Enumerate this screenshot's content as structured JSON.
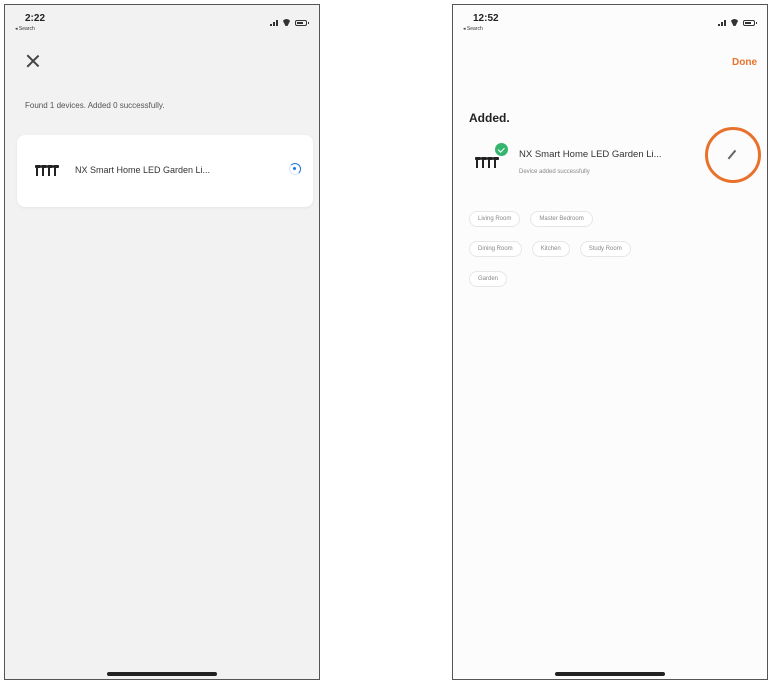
{
  "left_screen": {
    "status": {
      "time": "2:22",
      "back": "◂ Search"
    },
    "found_text": "Found 1 devices. Added 0 successfully.",
    "device": {
      "name": "NX Smart Home LED Garden Li..."
    }
  },
  "right_screen": {
    "status": {
      "time": "12:52",
      "back": "◂ Search"
    },
    "done_label": "Done",
    "added_title": "Added.",
    "device": {
      "name": "NX Smart Home LED Garden Li...",
      "status": "Device added successfully"
    },
    "rooms": [
      "Living Room",
      "Master Bedroom",
      "Dining Room",
      "Kitchen",
      "Study Room",
      "Garden"
    ]
  },
  "colors": {
    "accent": "#e8722c",
    "spinner": "#1a73e8",
    "check": "#35b56e"
  },
  "icons": [
    "close-icon",
    "garden-lights-icon",
    "loading-spinner-icon",
    "check-badge-icon",
    "edit-pencil-icon"
  ]
}
